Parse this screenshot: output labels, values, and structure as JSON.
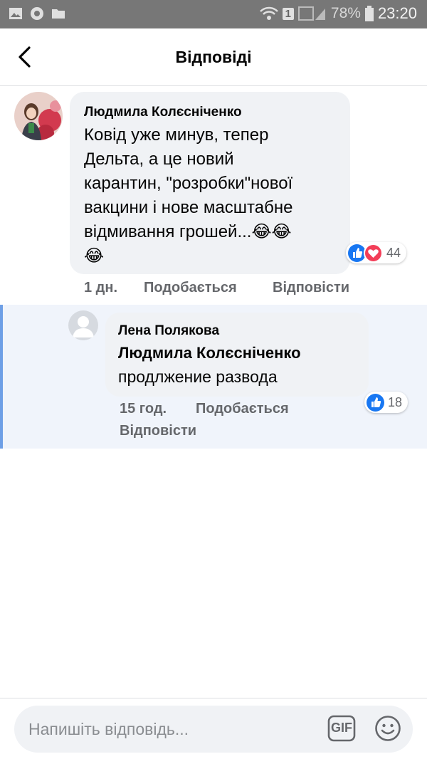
{
  "status_bar": {
    "battery": "78%",
    "time": "23:20",
    "sim_badge": "1"
  },
  "header": {
    "title": "Відповіді"
  },
  "comment": {
    "author": "Людмила Колєсніченко",
    "text": "Ковід уже минув, тепер\nДельта, а це новий\nкарантин,  \"розробки\"нової\nвакцини і нове масштабне\nвідмивання грошей...😂😂\n😂",
    "reaction_count": "44",
    "time": "1 дн.",
    "like_label": "Подобається",
    "reply_label": "Відповісти"
  },
  "reply": {
    "author": "Лена Полякова",
    "mention": "Людмила Колєсніченко",
    "text": "продлжение развода",
    "reaction_count": "18",
    "time": "15 год.",
    "like_label": "Подобається",
    "reply_label": "Відповісти"
  },
  "composer": {
    "placeholder": "Напишіть відповідь...",
    "gif_label": "GIF"
  },
  "colors": {
    "accent": "#1877f2",
    "love": "#f33e58",
    "reply_bar": "#6e9fe6"
  }
}
